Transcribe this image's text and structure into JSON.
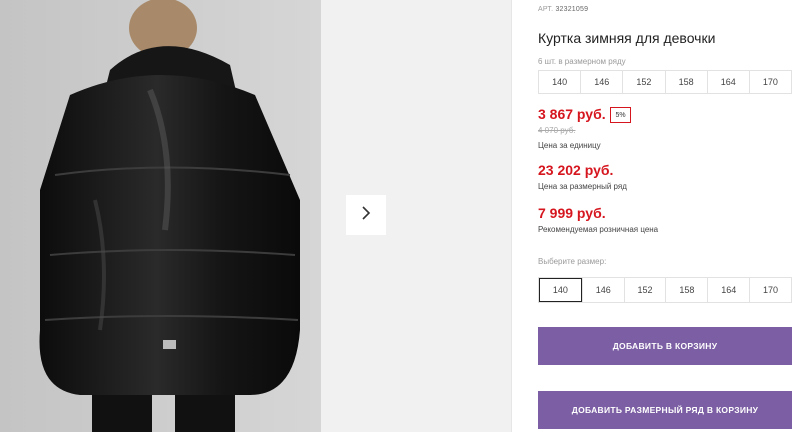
{
  "gallery": {
    "next_icon": "chevron-right-icon"
  },
  "product": {
    "article_label": "АРТ.",
    "article_number": "32321059",
    "title": "Куртка зимняя для девочки",
    "row_count_text": "6 шт. в размерном ряду",
    "row_sizes": [
      "140",
      "146",
      "152",
      "158",
      "164",
      "170"
    ]
  },
  "pricing": {
    "unit_price": "3 867 руб.",
    "discount": "5%",
    "old_price": "4 070 руб.",
    "unit_caption": "Цена за единицу",
    "row_price": "23 202 руб.",
    "row_caption": "Цена за размерный ряд",
    "rrp_price": "7 999 руб.",
    "rrp_caption": "Рекомендуемая розничная цена"
  },
  "size_selector": {
    "label": "Выберите размер:",
    "options": [
      "140",
      "146",
      "152",
      "158",
      "164",
      "170"
    ],
    "selected": "140"
  },
  "actions": {
    "add_to_cart": "ДОБАВИТЬ В КОРЗИНУ",
    "add_row_to_cart": "ДОБАВИТЬ РАЗМЕРНЫЙ РЯД В КОРЗИНУ"
  },
  "colors": {
    "price_red": "#d6161f",
    "button_purple": "#7b5ea3"
  }
}
